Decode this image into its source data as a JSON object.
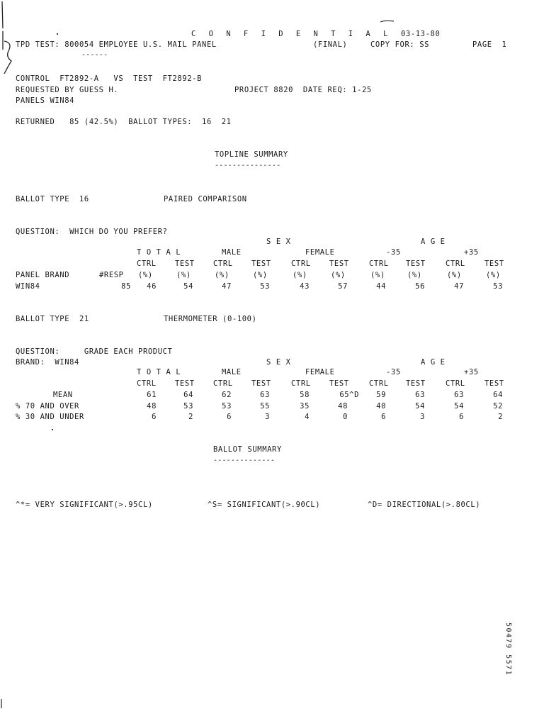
{
  "header": {
    "confidential": "C O N F I D E N T I A L",
    "date": "03-13-80",
    "test_line": "TPD TEST: 800054 EMPLOYEE U.S. MAIL PANEL",
    "final": "(FINAL)",
    "copy_for": "COPY FOR: SS",
    "page": "PAGE  1",
    "underline": "------"
  },
  "info": {
    "control_line": "CONTROL  FT2892-A   VS  TEST  FT2892-B",
    "requested_by": "REQUESTED BY GUESS H.",
    "project": "PROJECT 8820  DATE REQ: 1-25",
    "panels": "PANELS WIN84",
    "returned": "RETURNED   85 (42.5%)  BALLOT TYPES:  16  21"
  },
  "topline": {
    "title": "TOPLINE SUMMARY",
    "underline": "---------------"
  },
  "section1": {
    "ballot_type": "BALLOT TYPE  16",
    "ballot_desc": "PAIRED COMPARISON",
    "question": "QUESTION:  WHICH DO YOU PREFER?",
    "sex_header": "S E X",
    "age_header": "A G E",
    "col_groups": [
      "T O T A L",
      "MALE",
      "FEMALE",
      "-35",
      "+35"
    ],
    "subheaders": [
      "CTRL",
      "TEST",
      "CTRL",
      "TEST",
      "CTRL",
      "TEST",
      "CTRL",
      "TEST",
      "CTRL",
      "TEST"
    ],
    "row_label_header": "PANEL BRAND",
    "resp_header": "#RESP",
    "pct_headers": [
      "(%)",
      "(%)",
      "(%)",
      "(%)",
      "(%)",
      "(%)",
      "(%)",
      "(%)",
      "(%)",
      "(%)"
    ],
    "rows": [
      {
        "label": "WIN84",
        "resp": "85",
        "values": [
          "46",
          "54",
          "47",
          "53",
          "43",
          "57",
          "44",
          "56",
          "47",
          "53"
        ]
      }
    ]
  },
  "section2": {
    "ballot_type": "BALLOT TYPE  21",
    "ballot_desc": "THERMOMETER (0-100)",
    "question": "QUESTION:     GRADE EACH PRODUCT",
    "brand": "BRAND:  WIN84",
    "sex_header": "S E X",
    "age_header": "A G E",
    "col_groups": [
      "T O T A L",
      "MALE",
      "FEMALE",
      "-35",
      "+35"
    ],
    "subheaders": [
      "CTRL",
      "TEST",
      "CTRL",
      "TEST",
      "CTRL",
      "TEST",
      "CTRL",
      "TEST",
      "CTRL",
      "TEST"
    ],
    "rows": [
      {
        "label": "MEAN",
        "values": [
          "61",
          "64",
          "62",
          "63",
          "58",
          "65^D",
          "59",
          "63",
          "63",
          "64"
        ]
      },
      {
        "label": "% 70 AND OVER",
        "values": [
          "48",
          "53",
          "53",
          "55",
          "35",
          "48",
          "40",
          "54",
          "54",
          "52"
        ]
      },
      {
        "label": "% 30 AND UNDER",
        "values": [
          "6",
          "2",
          "6",
          "3",
          "4",
          "0",
          "6",
          "3",
          "6",
          "2"
        ]
      }
    ]
  },
  "ballot_summary": {
    "title": "BALLOT SUMMARY",
    "underline": "--------------"
  },
  "legend": {
    "very_sig": "^*= VERY SIGNIFICANT(>.95CL)",
    "sig": "^S= SIGNIFICANT(>.90CL)",
    "dir": "^D= DIRECTIONAL(>.80CL)"
  },
  "stamp": "50479 5571"
}
